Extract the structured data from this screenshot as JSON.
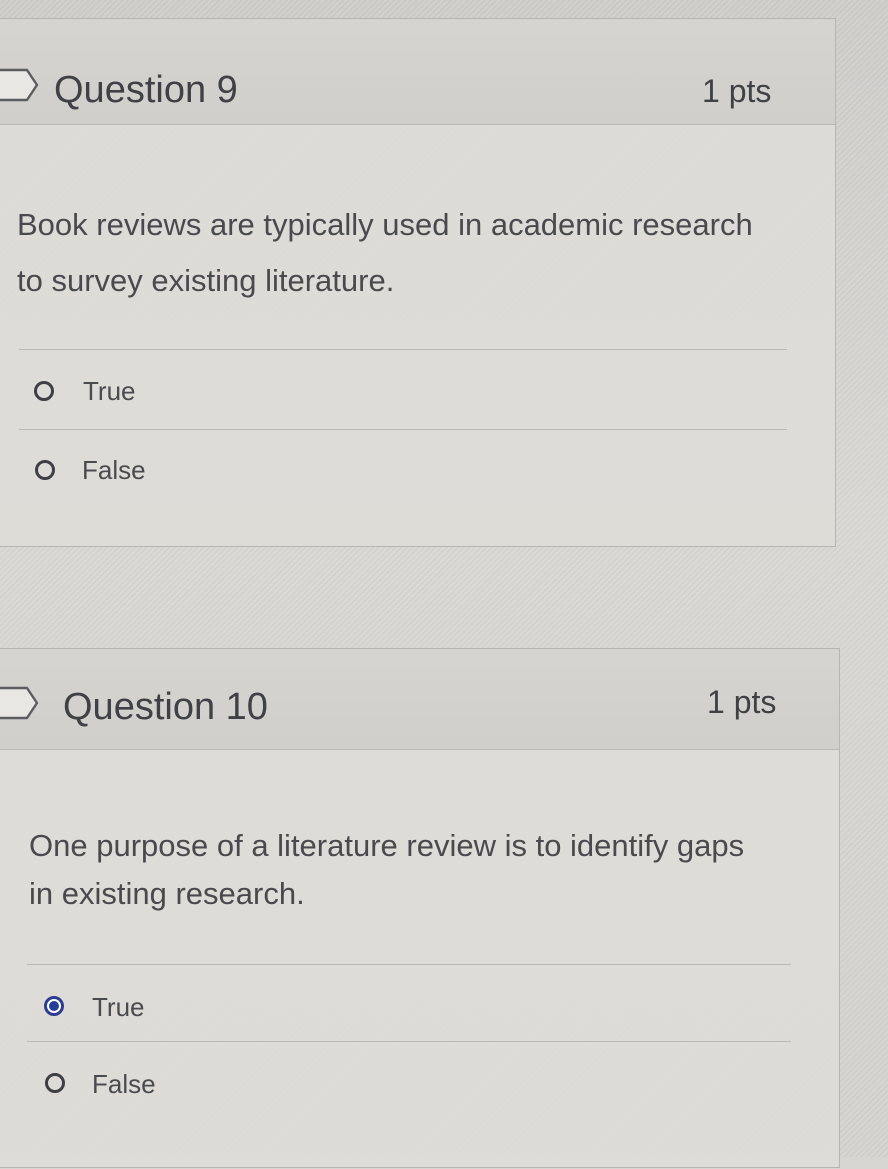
{
  "questions": [
    {
      "title": "Question 9",
      "points": "1 pts",
      "text_line_1": "Book reviews are typically used in academic research",
      "text_line_2": "to survey existing literature.",
      "answers": [
        {
          "label": "True",
          "selected": false
        },
        {
          "label": "False",
          "selected": false
        }
      ]
    },
    {
      "title": "Question 10",
      "points": "1 pts",
      "text_line_1": "One purpose of a literature review is to identify gaps",
      "text_line_2": "in existing research.",
      "answers": [
        {
          "label": "True",
          "selected": true
        },
        {
          "label": "False",
          "selected": false
        }
      ]
    }
  ],
  "colors": {
    "text": "#4a4a4e",
    "selected_radio": "#253c9a",
    "border": "#b7b6b2"
  },
  "icons": {
    "flag": "flag-question-icon",
    "radio": "radio-icon"
  }
}
